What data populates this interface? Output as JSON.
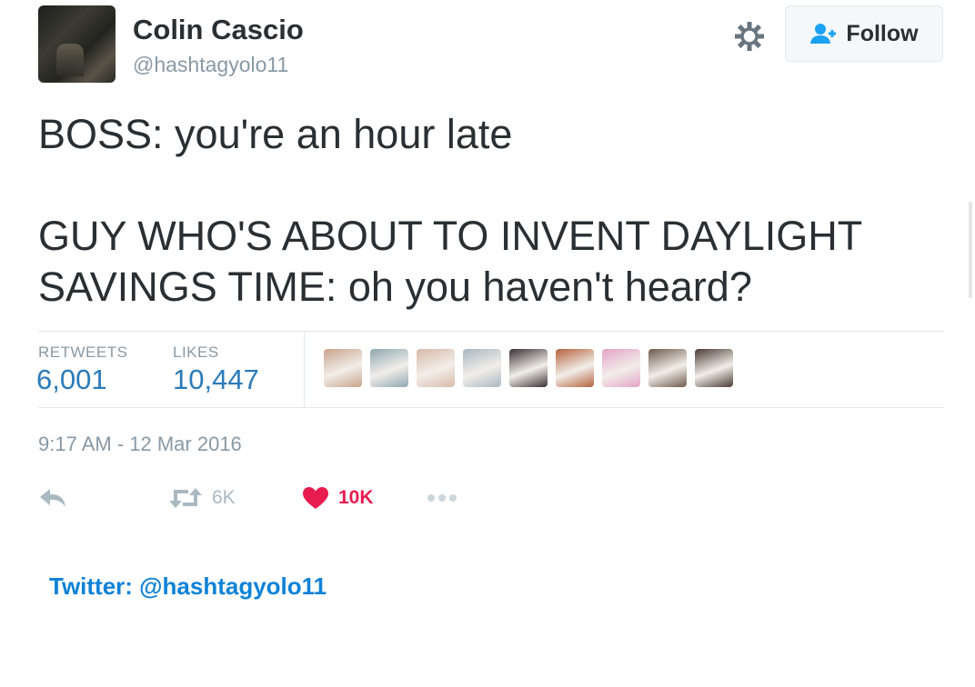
{
  "tweet": {
    "author": {
      "name": "Colin Cascio",
      "handle": "@hashtagyolo11"
    },
    "follow_label": "Follow",
    "text_lines": [
      "BOSS: you're an hour late",
      "GUY WHO'S ABOUT TO INVENT DAYLIGHT",
      "SAVINGS TIME: oh you haven't heard?"
    ],
    "stats": {
      "retweets_label": "RETWEETS",
      "retweets_value": "6,001",
      "likes_label": "LIKES",
      "likes_value": "10,447"
    },
    "liker_avatars": [
      {
        "color": "#c9a38c"
      },
      {
        "color": "#8fa7b0"
      },
      {
        "color": "#d7b9a8"
      },
      {
        "color": "#a9b7c2"
      },
      {
        "color": "#3a3136"
      },
      {
        "color": "#b4623c"
      },
      {
        "color": "#e4a3c7"
      },
      {
        "color": "#6d5a4c"
      },
      {
        "color": "#4a3b33"
      }
    ],
    "timestamp": "9:17 AM - 12 Mar 2016",
    "actions": {
      "retweet_count": "6K",
      "like_count": "10K"
    }
  },
  "credit": "Twitter: @hashtagyolo11",
  "colors": {
    "link_blue": "#2b7bb9",
    "like_red": "#e81c4f",
    "muted_gray": "#8899a6",
    "credit_blue": "#0f82d8"
  },
  "icons": [
    "gear-icon",
    "add-user-icon",
    "reply-icon",
    "retweet-icon",
    "heart-icon",
    "more-icon"
  ]
}
